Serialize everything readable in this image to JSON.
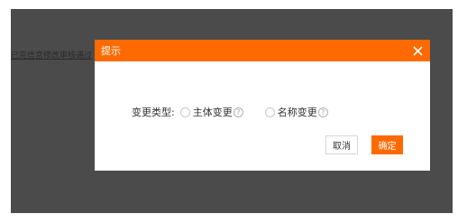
{
  "background": {
    "link_text": "已完信息修改审核通过"
  },
  "dialog": {
    "title": "提示",
    "close_icon": "close-icon",
    "field_label": "变更类型:",
    "options": [
      {
        "label": "主体变更",
        "selected": false
      },
      {
        "label": "名称变更",
        "selected": false
      }
    ],
    "help_symbol": "?",
    "cancel_label": "取消",
    "ok_label": "确定"
  },
  "colors": {
    "accent": "#ff6a00",
    "overlay": "#4b4b4b"
  }
}
